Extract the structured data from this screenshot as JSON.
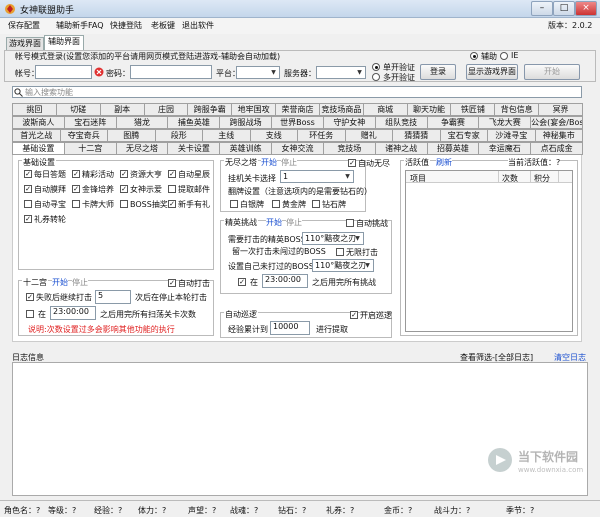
{
  "window": {
    "title": "女神联盟助手",
    "min": "–",
    "max": "□",
    "close": "×"
  },
  "menu": [
    "保存配置",
    "辅助新手FAQ",
    "快捷登陆",
    "老板键",
    "退出软件"
  ],
  "version": "版本：2.0.2",
  "tabs": [
    "游戏界面",
    "辅助界面"
  ],
  "account_header": "帐号模式登录(设置您添加的平台请用网页模式登陆进游戏-辅助会自动加载)",
  "mode": {
    "assist": "辅助",
    "ie": "IE"
  },
  "login": {
    "account_label": "帐号：",
    "password_label": "密码：",
    "platform_label": "平台：",
    "server_label": "服务器：",
    "single": "单开验证",
    "multi": "多开验证",
    "login_btn": "登录",
    "show_btn": "显示游戏界面",
    "start_btn": "开始"
  },
  "search_placeholder": "输入搜索功能",
  "feature_rows": [
    [
      "挑回",
      "切磋",
      "副本",
      "庄园",
      "跨服争霸",
      "地牢国攻",
      "荣誉商店",
      "竞技场商品",
      "商城",
      "聊天功能",
      "铁匠铺",
      "背包信息",
      "冥界"
    ],
    [
      "波斯商人",
      "宝石迷阵",
      "猎龙",
      "捕鱼英雄",
      "跨服战场",
      "世界Boss",
      "守护女神",
      "组队竞技",
      "争霸赛",
      "飞龙大赛",
      "公会(宴会/Boss/捐献)"
    ],
    [
      "首光之战",
      "夺宝奇兵",
      "图腾",
      "段形",
      "主线",
      "支线",
      "环任务",
      "赠礼",
      "猜猜猜",
      "宝石专家",
      "沙滩寻宝",
      "神秘集市"
    ],
    [
      "基础设置",
      "十二宫",
      "无尽之塔",
      "关卡设置",
      "英雄训练",
      "女神交流",
      "竞技场",
      "诸神之战",
      "招募英雄",
      "幸运魔石",
      "点石成金"
    ]
  ],
  "basic": {
    "title": "基础设置",
    "items": [
      [
        "每日答题",
        "精彩活动",
        "资源大亨",
        "自动星辰"
      ],
      [
        "自动膜拜",
        "金锋培养",
        "女神示爱",
        "提取邮件"
      ],
      [
        "自动寻宝",
        "卡牌大师",
        "BOSS抽奖",
        "新手有礼"
      ],
      [
        "礼券转轮"
      ]
    ],
    "checked": [
      [
        true,
        true,
        true,
        true
      ],
      [
        true,
        true,
        true,
        false
      ],
      [
        false,
        false,
        false,
        true
      ],
      [
        true
      ]
    ]
  },
  "zodiac": {
    "title": "十二宫",
    "start": "开始",
    "stop": "停止",
    "auto": "自动打击",
    "fail_label": "失败后继续打击",
    "fail_value": "5",
    "fail_after": "次后在停止本轮打击",
    "at": "在",
    "time": "23:00:00",
    "after": "之后用完所有扫荡关卡次数",
    "note": "说明:次数设置过多会影响其他功能的执行"
  },
  "tower": {
    "title": "无尽之塔",
    "start": "开始",
    "stop": "停止",
    "auto": "自动无尽",
    "floor_label": "挂机关卡选择",
    "floor_value": "1",
    "reset_label": "翻牌设置（注意选项内的是需要钻石的）",
    "cards": [
      "白银牌",
      "黄金牌",
      "钻石牌"
    ]
  },
  "elite": {
    "title": "精英挑战",
    "start": "开始",
    "stop": "停止",
    "auto": "自动挑战",
    "need_label": "需要打击的精英BOSS",
    "need_value": "110°黯夜之刃",
    "keep_label": "留一次打击未闯过的BOSS",
    "unlimited": "无限打击",
    "my_label": "设置自己未打过的BOSS",
    "my_value": "110°黯夜之刃",
    "at": "在",
    "time": "23:00:00",
    "after": "之后用完所有挑战"
  },
  "patrol": {
    "title": "自动巡逻",
    "open": "开启巡逻",
    "exp_label": "经验累计到",
    "exp_value": "10000",
    "exp_after": "进行提取"
  },
  "activity": {
    "title": "活跃值",
    "refresh": "刷新",
    "current": "当前活跃值：?",
    "columns": [
      "项目",
      "次数",
      "积分"
    ]
  },
  "log": {
    "title": "日志信息",
    "filter": "查看筛选-[全部日志]",
    "clear": "清空日志"
  },
  "status": [
    "角色名：?",
    "等级：?",
    "经验：?",
    "体力：?",
    "声望：?",
    "战魂：?",
    "钻石：?",
    "礼券：?",
    "金币：?",
    "战斗力：?",
    "季节：?"
  ],
  "watermark": "当下软件园",
  "watermark_url": "www.downxia.com"
}
